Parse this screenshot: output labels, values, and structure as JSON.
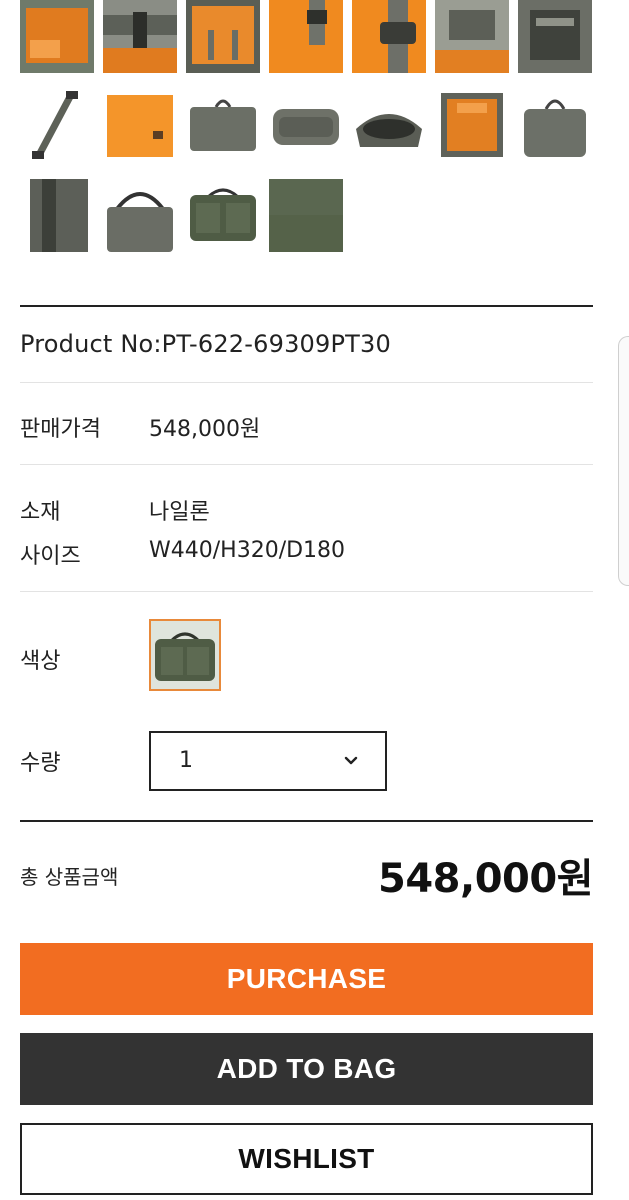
{
  "gallery": {
    "thumbnails": [
      {
        "name": "bag-interior-orange",
        "colors": [
          "#e07b1f",
          "#6f7a6a"
        ]
      },
      {
        "name": "buckle-strap",
        "colors": [
          "#e07b1f",
          "#4a4f47"
        ]
      },
      {
        "name": "bag-open-orange-lining",
        "colors": [
          "#e98a2c",
          "#5a5e55"
        ]
      },
      {
        "name": "orange-pocket-detail",
        "colors": [
          "#f08a1f",
          "#e07b1f"
        ]
      },
      {
        "name": "buckle-detail",
        "colors": [
          "#f08a1f",
          "#6d6f68"
        ]
      },
      {
        "name": "porter-label-detail",
        "colors": [
          "#9a9d93",
          "#e27f22"
        ]
      },
      {
        "name": "porter-tag",
        "colors": [
          "#6b6e66",
          "#3f423c"
        ]
      },
      {
        "name": "shoulder-strap",
        "colors": [
          "#ffffff",
          "#5d6158"
        ]
      },
      {
        "name": "orange-pouch",
        "colors": [
          "#f4952a",
          "#ffffff"
        ]
      },
      {
        "name": "bag-front-grey",
        "colors": [
          "#ffffff",
          "#6b6f66"
        ]
      },
      {
        "name": "bag-bottom-grey",
        "colors": [
          "#ffffff",
          "#6e7168"
        ]
      },
      {
        "name": "bag-open-top",
        "colors": [
          "#ffffff",
          "#5a5d55"
        ]
      },
      {
        "name": "bag-open-inside",
        "colors": [
          "#ffffff",
          "#e27f22"
        ]
      },
      {
        "name": "bag-side-grey",
        "colors": [
          "#ffffff",
          "#6c7068"
        ]
      },
      {
        "name": "strap-closeup",
        "colors": [
          "#ffffff",
          "#5c5f58"
        ]
      },
      {
        "name": "bag-handles-grey",
        "colors": [
          "#ffffff",
          "#6a6d65"
        ]
      },
      {
        "name": "bag-front-olive",
        "colors": [
          "#ffffff",
          "#4f5c45"
        ]
      },
      {
        "name": "olive-fabric-swatch",
        "colors": [
          "#5a6750",
          "#4d5a44"
        ]
      }
    ]
  },
  "product": {
    "product_no": "Product No:PT-622-69309PT30",
    "price_label": "판매가격",
    "price_value": "548,000원",
    "material_label": "소재",
    "material_value": "나일론",
    "size_label": "사이즈",
    "size_value": "W440/H320/D180",
    "color_label": "색상",
    "color_swatch": "olive-bag",
    "qty_label": "수량",
    "qty_value": "1"
  },
  "total": {
    "label": "총 상품금액",
    "value": "548,000원"
  },
  "buttons": {
    "purchase": "PURCHASE",
    "add_to_bag": "ADD TO BAG",
    "wishlist": "WISHLIST"
  },
  "colors": {
    "accent": "#f26d21",
    "dark_button": "#333333",
    "swatch_border": "#e8893a"
  }
}
